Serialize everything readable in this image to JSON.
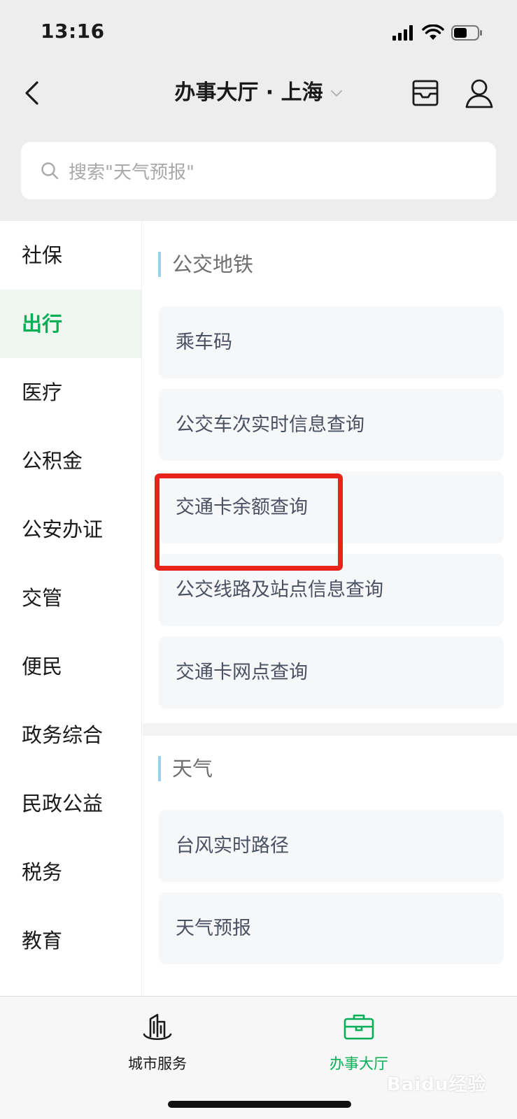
{
  "status_bar": {
    "time": "13:16"
  },
  "nav": {
    "title": "办事大厅 · 上海"
  },
  "search": {
    "placeholder": "搜索\"天气预报\""
  },
  "sidebar": {
    "items": [
      {
        "label": "社保"
      },
      {
        "label": "出行",
        "active": true
      },
      {
        "label": "医疗"
      },
      {
        "label": "公积金"
      },
      {
        "label": "公安办证"
      },
      {
        "label": "交管"
      },
      {
        "label": "便民"
      },
      {
        "label": "政务综合"
      },
      {
        "label": "民政公益"
      },
      {
        "label": "税务"
      },
      {
        "label": "教育"
      }
    ]
  },
  "sections": [
    {
      "title": "公交地铁",
      "items": [
        {
          "label": "乘车码"
        },
        {
          "label": "公交车次实时信息查询"
        },
        {
          "label": "交通卡余额查询",
          "highlighted": true
        },
        {
          "label": "公交线路及站点信息查询"
        },
        {
          "label": "交通卡网点查询"
        }
      ]
    },
    {
      "title": "天气",
      "items": [
        {
          "label": "台风实时路径"
        },
        {
          "label": "天气预报"
        }
      ]
    }
  ],
  "tabs": [
    {
      "label": "城市服务",
      "icon": "city-building-icon"
    },
    {
      "label": "办事大厅",
      "icon": "briefcase-icon",
      "active": true
    }
  ],
  "watermark": {
    "text": "Baidu经验"
  },
  "colors": {
    "accent": "#06ae56",
    "highlight": "#e8231a",
    "section_bar": "#9bd0e8"
  }
}
